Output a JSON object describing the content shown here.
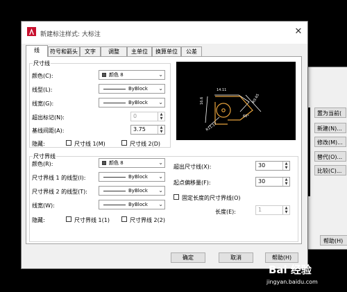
{
  "dialog": {
    "title": "新建标注样式: 大标注",
    "close_glyph": "✕",
    "tabs": [
      "线",
      "符号和箭头",
      "文字",
      "调整",
      "主单位",
      "换算单位",
      "公差"
    ],
    "dim_lines": {
      "group_label": "尺寸线",
      "color_label": "颜色(C):",
      "color_value": "颜色 8",
      "linetype_label": "线型(L):",
      "linetype_value": "ByBlock",
      "lineweight_label": "线宽(G):",
      "lineweight_value": "ByBlock",
      "extend_ticks_label": "超出标记(N):",
      "extend_ticks_value": "0",
      "baseline_spacing_label": "基线间距(A):",
      "baseline_spacing_value": "3.75",
      "suppress_label": "隐藏:",
      "suppress_1": "尺寸线 1(M)",
      "suppress_2": "尺寸线 2(D)"
    },
    "ext_lines": {
      "group_label": "尺寸界线",
      "color_label": "颜色(R):",
      "color_value": "颜色 8",
      "ext1_linetype_label": "尺寸界线 1 的线型(I):",
      "ext1_linetype_value": "ByBlock",
      "ext2_linetype_label": "尺寸界线 2 的线型(T):",
      "ext2_linetype_value": "ByBlock",
      "lineweight_label": "线宽(W):",
      "lineweight_value": "ByBlock",
      "suppress_label": "隐藏:",
      "suppress_1": "尺寸界线 1(1)",
      "suppress_2": "尺寸界线 2(2)",
      "extend_beyond_label": "超出尺寸线(X):",
      "extend_beyond_value": "30",
      "offset_origin_label": "起点偏移量(F):",
      "offset_origin_value": "30",
      "fixed_length_label": "固定长度的尺寸界线(O)",
      "length_label": "长度(E):",
      "length_value": "1"
    },
    "preview": {
      "dim_top": "14.11",
      "dim_left": "16.6",
      "dim_right": "R9.65",
      "dim_angle": "60°",
      "dim_bottom": "R11.17"
    },
    "buttons": {
      "ok": "确定",
      "cancel": "取消",
      "help": "帮助(H)"
    }
  },
  "background_dialog": {
    "buttons": [
      "置为当前(",
      "新建(N)...",
      "修改(M)...",
      "替代(O)...",
      "比较(C)..."
    ],
    "help": "帮助(H)"
  },
  "watermark": {
    "text": "Bai 经验",
    "url": "jingyan.baidu.com"
  },
  "colors": {
    "accent": "#e8a33c",
    "preview_bg": "#000000",
    "dialog_bg": "#f0f0f0"
  }
}
